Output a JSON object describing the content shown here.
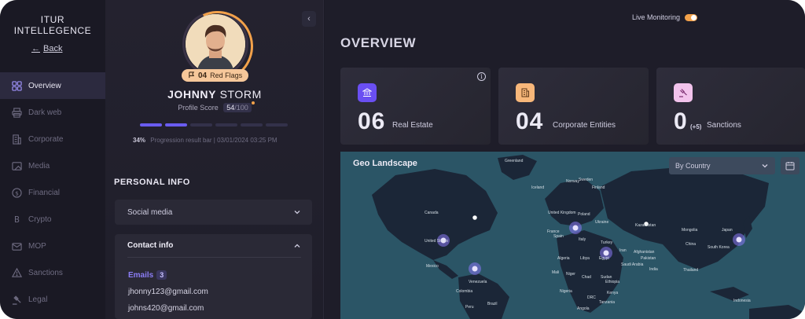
{
  "app": {
    "logo_line1": "ITUR",
    "logo_line2": "INTELLEGENCE",
    "back_label": "Back"
  },
  "sidebar": {
    "items": [
      {
        "label": "Overview",
        "icon": "grid-icon",
        "active": true
      },
      {
        "label": "Dark web",
        "icon": "printer-icon",
        "active": false
      },
      {
        "label": "Corporate",
        "icon": "building-icon",
        "active": false
      },
      {
        "label": "Media",
        "icon": "media-icon",
        "active": false
      },
      {
        "label": "Financial",
        "icon": "dollar-icon",
        "active": false
      },
      {
        "label": "Crypto",
        "icon": "bitcoin-icon",
        "active": false
      },
      {
        "label": "MOP",
        "icon": "mail-icon",
        "active": false
      },
      {
        "label": "Sanctions",
        "icon": "warning-icon",
        "active": false
      },
      {
        "label": "Legal",
        "icon": "gavel-icon",
        "active": false
      }
    ]
  },
  "profile": {
    "red_flags_count": "04",
    "red_flags_label": "Red Flags",
    "first_name": "JOHNNY",
    "last_name": "STORM",
    "score_label": "Profile Score",
    "score_value": "54",
    "score_max": "/100",
    "progress_percent": "34%",
    "progress_segments_filled": 2,
    "progress_segments_total": 6,
    "progress_caption": "Progression result bar",
    "progress_separator": "|",
    "progress_date": "03/01/2024 03:25 PM"
  },
  "personal_info": {
    "title": "PERSONAL INFO",
    "social_media_label": "Social media",
    "contact_info_label": "Contact info",
    "emails_label": "Emails",
    "emails_count": "3",
    "emails": [
      "jhonny123@gmail.com",
      "johns420@gmail.com"
    ]
  },
  "main": {
    "live_monitoring_label": "Live Monitoring",
    "live_monitoring_on": true,
    "overview_title": "OVERVIEW",
    "cards": [
      {
        "value": "06",
        "label": "Real Estate",
        "icon": "bank-icon",
        "icon_bg": "#6a4ff2",
        "icon_fg": "#ffffff"
      },
      {
        "value": "04",
        "label": "Corporate Entities",
        "icon": "office-icon",
        "icon_bg": "#f7b77a",
        "icon_fg": "#5a3417"
      },
      {
        "value": "0",
        "extra": "(+5)",
        "label": "Sanctions",
        "icon": "gavel-icon",
        "icon_bg": "#f2c3ec",
        "icon_fg": "#7a2d6f"
      }
    ],
    "geo_title": "Geo Landscape",
    "geo_select_value": "By Country",
    "map_labels": [
      "Greenland",
      "Iceland",
      "Sweden",
      "Finland",
      "Norway",
      "Canada",
      "United Kingdom",
      "Poland",
      "Ukraine",
      "France",
      "Kazakhstan",
      "Mongolia",
      "Spain",
      "Italy",
      "Turkey",
      "United States",
      "China",
      "Japan",
      "South Korea",
      "Iran",
      "Afghanistan",
      "Pakistan",
      "Mexico",
      "Algeria",
      "Libya",
      "Egypt",
      "Saudi Arabia",
      "India",
      "Thailand",
      "Mali",
      "Niger",
      "Chad",
      "Sudan",
      "Venezuela",
      "Colombia",
      "Nigeria",
      "Ethiopia",
      "Kenya",
      "DRC",
      "Tanzania",
      "Peru",
      "Brazil",
      "Angola",
      "Indonesia"
    ]
  },
  "colors": {
    "accent": "#6a5cf0",
    "warning": "#f2a14a",
    "map_ocean": "#2b5566",
    "map_land": "#1b2637"
  }
}
